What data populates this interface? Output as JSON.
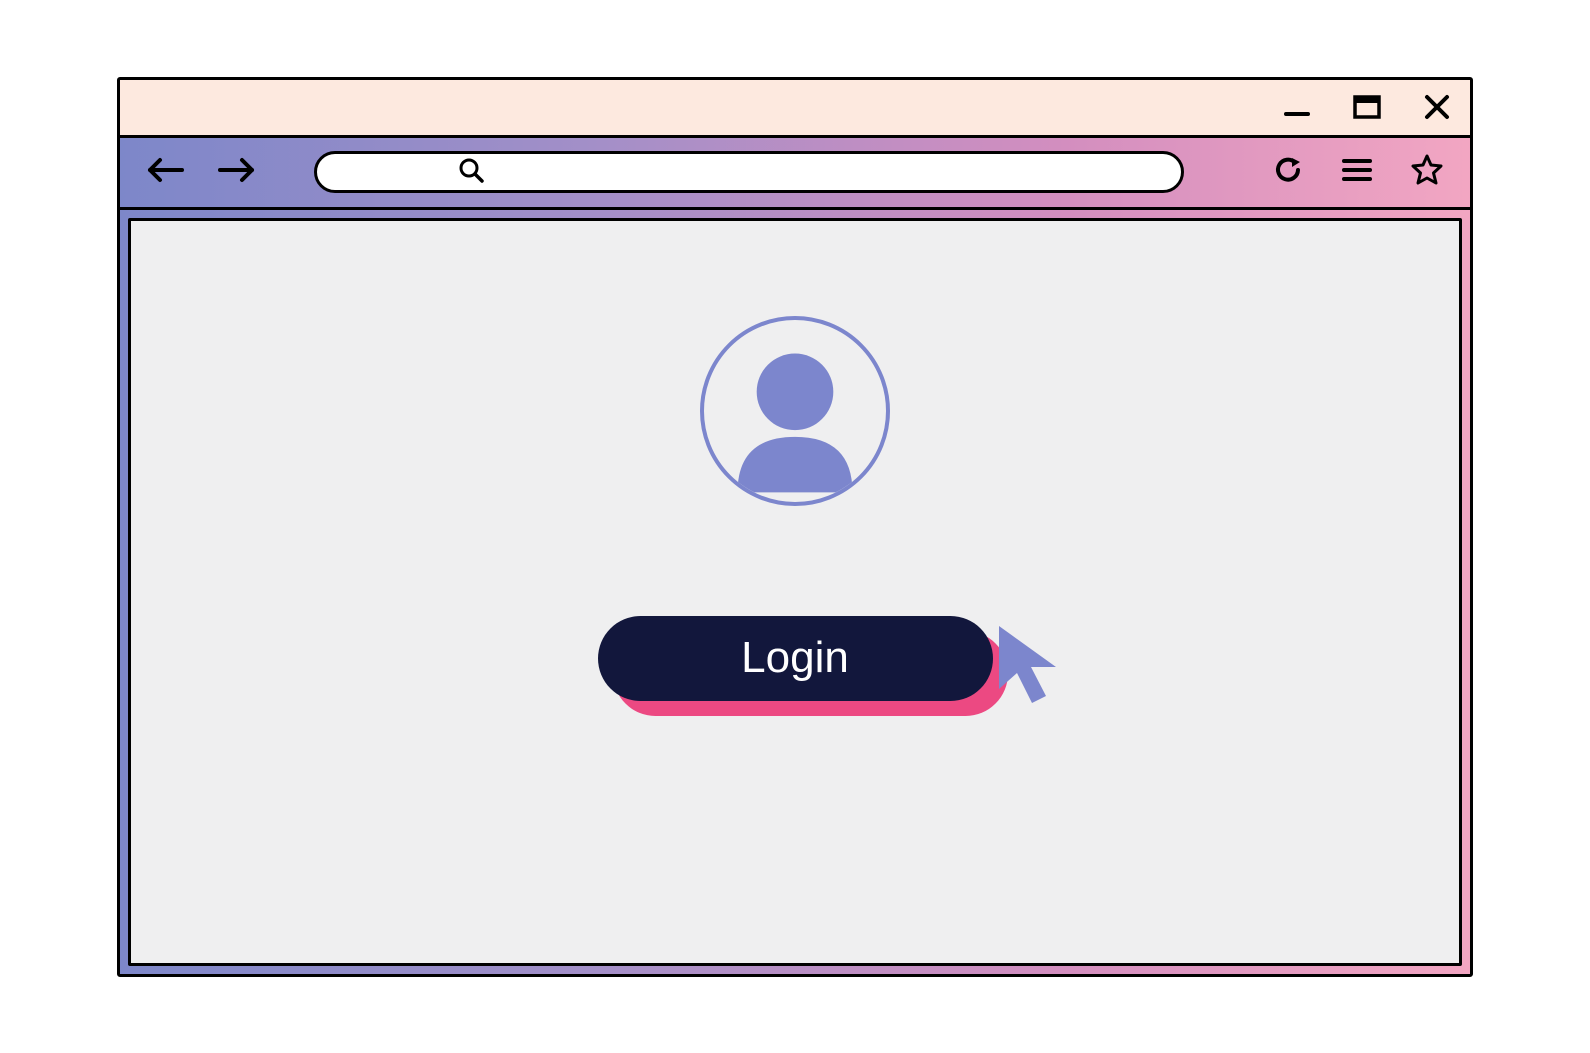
{
  "main": {
    "login_label": "Login"
  },
  "toolbar": {
    "search_placeholder": ""
  },
  "icons": {
    "minimize": "minimize-icon",
    "maximize": "maximize-icon",
    "close": "close-icon",
    "back": "back-arrow-icon",
    "forward": "forward-arrow-icon",
    "search": "search-icon",
    "reload": "reload-icon",
    "menu": "hamburger-menu-icon",
    "star": "star-icon",
    "avatar": "user-avatar-icon",
    "cursor": "cursor-arrow-icon"
  }
}
